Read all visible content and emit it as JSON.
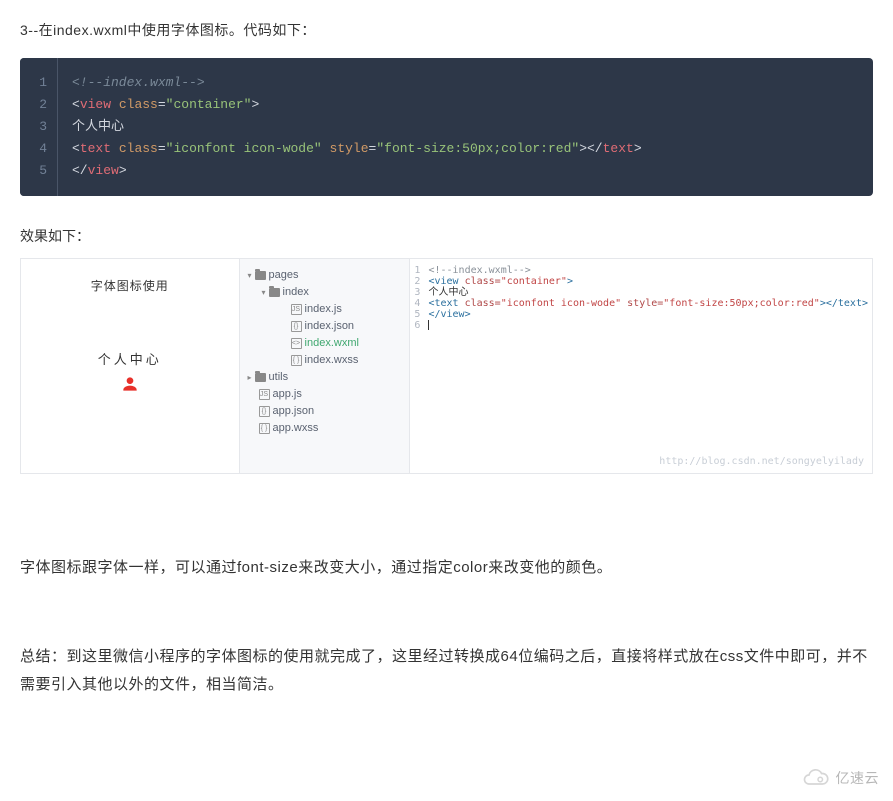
{
  "intro": "3--在index.wxml中使用字体图标。代码如下：",
  "code": {
    "lines": [
      "1",
      "2",
      "3",
      "4",
      "5"
    ],
    "l1_comment": "<!--index.wxml-->",
    "l2_open": "<",
    "l2_tag": "view",
    "l2_sp": " ",
    "l2_attr": "class",
    "l2_eq": "=",
    "l2_str": "\"container\"",
    "l2_close": ">",
    "l3_text": "个人中心",
    "l4_open": "<",
    "l4_tag": "text",
    "l4_sp": " ",
    "l4_attr1": "class",
    "l4_eq1": "=",
    "l4_str1": "\"iconfont icon-wode\"",
    "l4_sp2": " ",
    "l4_attr2": "style",
    "l4_eq2": "=",
    "l4_str2": "\"font-size:50px;color:red\"",
    "l4_close1": ">",
    "l4_open2": "</",
    "l4_tag2": "text",
    "l4_close2": ">",
    "l5_open": "</",
    "l5_tag": "view",
    "l5_close": ">"
  },
  "resultLabel": "效果如下：",
  "sim": {
    "headerTitle": "字体图标使用",
    "dots": "•••",
    "bodyLabel": "个人中心",
    "iconName": "person-icon",
    "iconColor": "#e8302a"
  },
  "tree": {
    "items": [
      {
        "level": 0,
        "expand": "▾",
        "type": "folder",
        "label": "pages"
      },
      {
        "level": 1,
        "expand": "▾",
        "type": "folder",
        "label": "index"
      },
      {
        "level": 2,
        "expand": "",
        "type": "js",
        "label": "index.js"
      },
      {
        "level": 2,
        "expand": "",
        "type": "json",
        "label": "index.json"
      },
      {
        "level": 2,
        "expand": "",
        "type": "wxml",
        "label": "index.wxml",
        "active": true
      },
      {
        "level": 2,
        "expand": "",
        "type": "wxss",
        "label": "index.wxss"
      },
      {
        "level": 0,
        "expand": "▸",
        "type": "folder",
        "label": "utils"
      },
      {
        "level": 0,
        "expand": "",
        "type": "js",
        "label": "app.js"
      },
      {
        "level": 0,
        "expand": "",
        "type": "json",
        "label": "app.json"
      },
      {
        "level": 0,
        "expand": "",
        "type": "wxss",
        "label": "app.wxss"
      }
    ]
  },
  "editor": {
    "gutter": [
      "1",
      "2",
      "3",
      "4",
      "5",
      "6"
    ],
    "l1": "<!--index.wxml-->",
    "l2_a": "<view ",
    "l2_b": "class=",
    "l2_c": "\"container\"",
    "l2_d": ">",
    "l3": "个人中心",
    "l4_a": "<text ",
    "l4_b": "class=",
    "l4_c": "\"iconfont icon-wode\"",
    "l4_d": " ",
    "l4_e": "style=",
    "l4_f": "\"font-size:50px;color:red\"",
    "l4_g": "></text>",
    "l5": "</view>"
  },
  "watermark": "http://blog.csdn.net/songyelyilady",
  "para1": "字体图标跟字体一样，可以通过font-size来改变大小，通过指定color来改变他的颜色。",
  "para2": "总结：到这里微信小程序的字体图标的使用就完成了，这里经过转换成64位编码之后，直接将样式放在css文件中即可，并不需要引入其他以外的文件，相当简洁。",
  "brand": "亿速云"
}
